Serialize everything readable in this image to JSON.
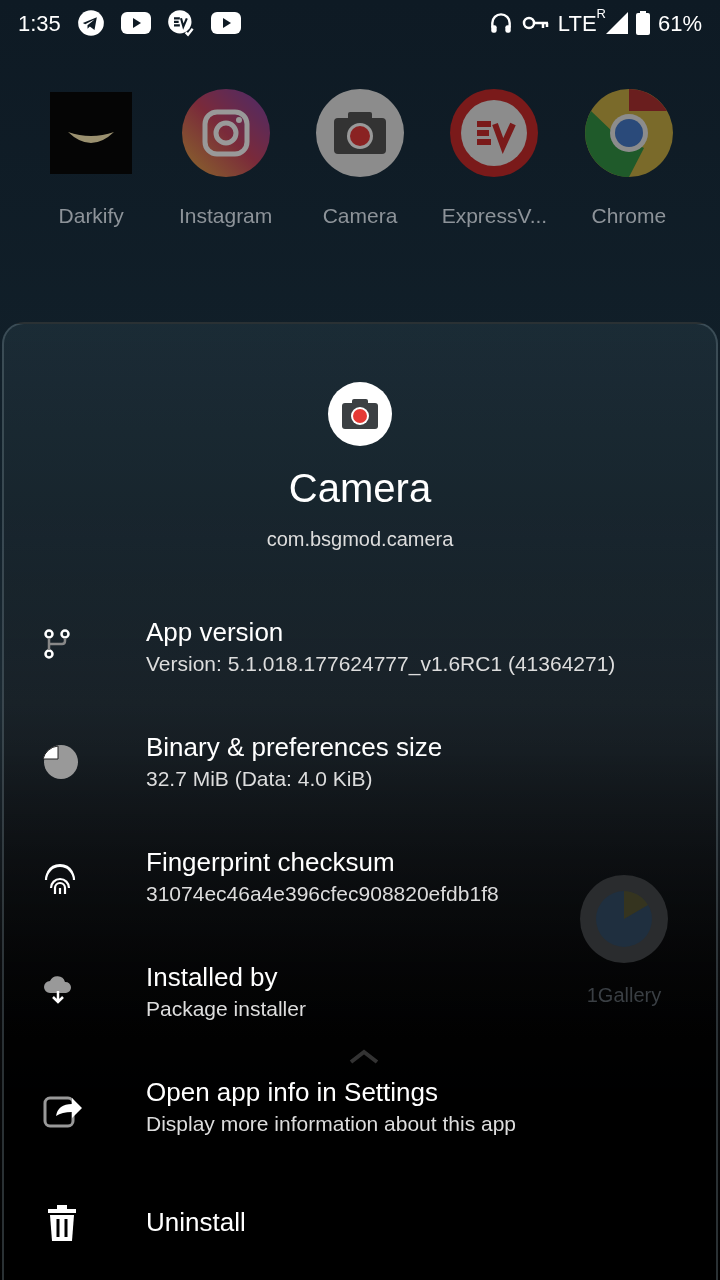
{
  "status_bar": {
    "time": "1:35",
    "network": "LTE",
    "roaming": "R",
    "battery": "61%"
  },
  "home_apps": [
    {
      "label": "Darkify"
    },
    {
      "label": "Instagram"
    },
    {
      "label": "Camera"
    },
    {
      "label": "ExpressV..."
    },
    {
      "label": "Chrome"
    }
  ],
  "background_app": {
    "label": "1Gallery"
  },
  "app_sheet": {
    "title": "Camera",
    "package": "com.bsgmod.camera",
    "items": [
      {
        "kind": "version",
        "title": "App version",
        "subtitle": "Version: 5.1.018.177624777_v1.6RC1 (41364271)"
      },
      {
        "kind": "size",
        "title": "Binary & preferences size",
        "subtitle": "32.7 MiB (Data: 4.0 KiB)"
      },
      {
        "kind": "checksum",
        "title": "Fingerprint checksum",
        "subtitle": "31074ec46a4e396cfec908820efdb1f8"
      },
      {
        "kind": "installer",
        "title": "Installed by",
        "subtitle": "Package installer"
      },
      {
        "kind": "settings",
        "title": "Open app info in Settings",
        "subtitle": "Display more information about this app"
      },
      {
        "kind": "uninstall",
        "title": "Uninstall"
      }
    ]
  }
}
